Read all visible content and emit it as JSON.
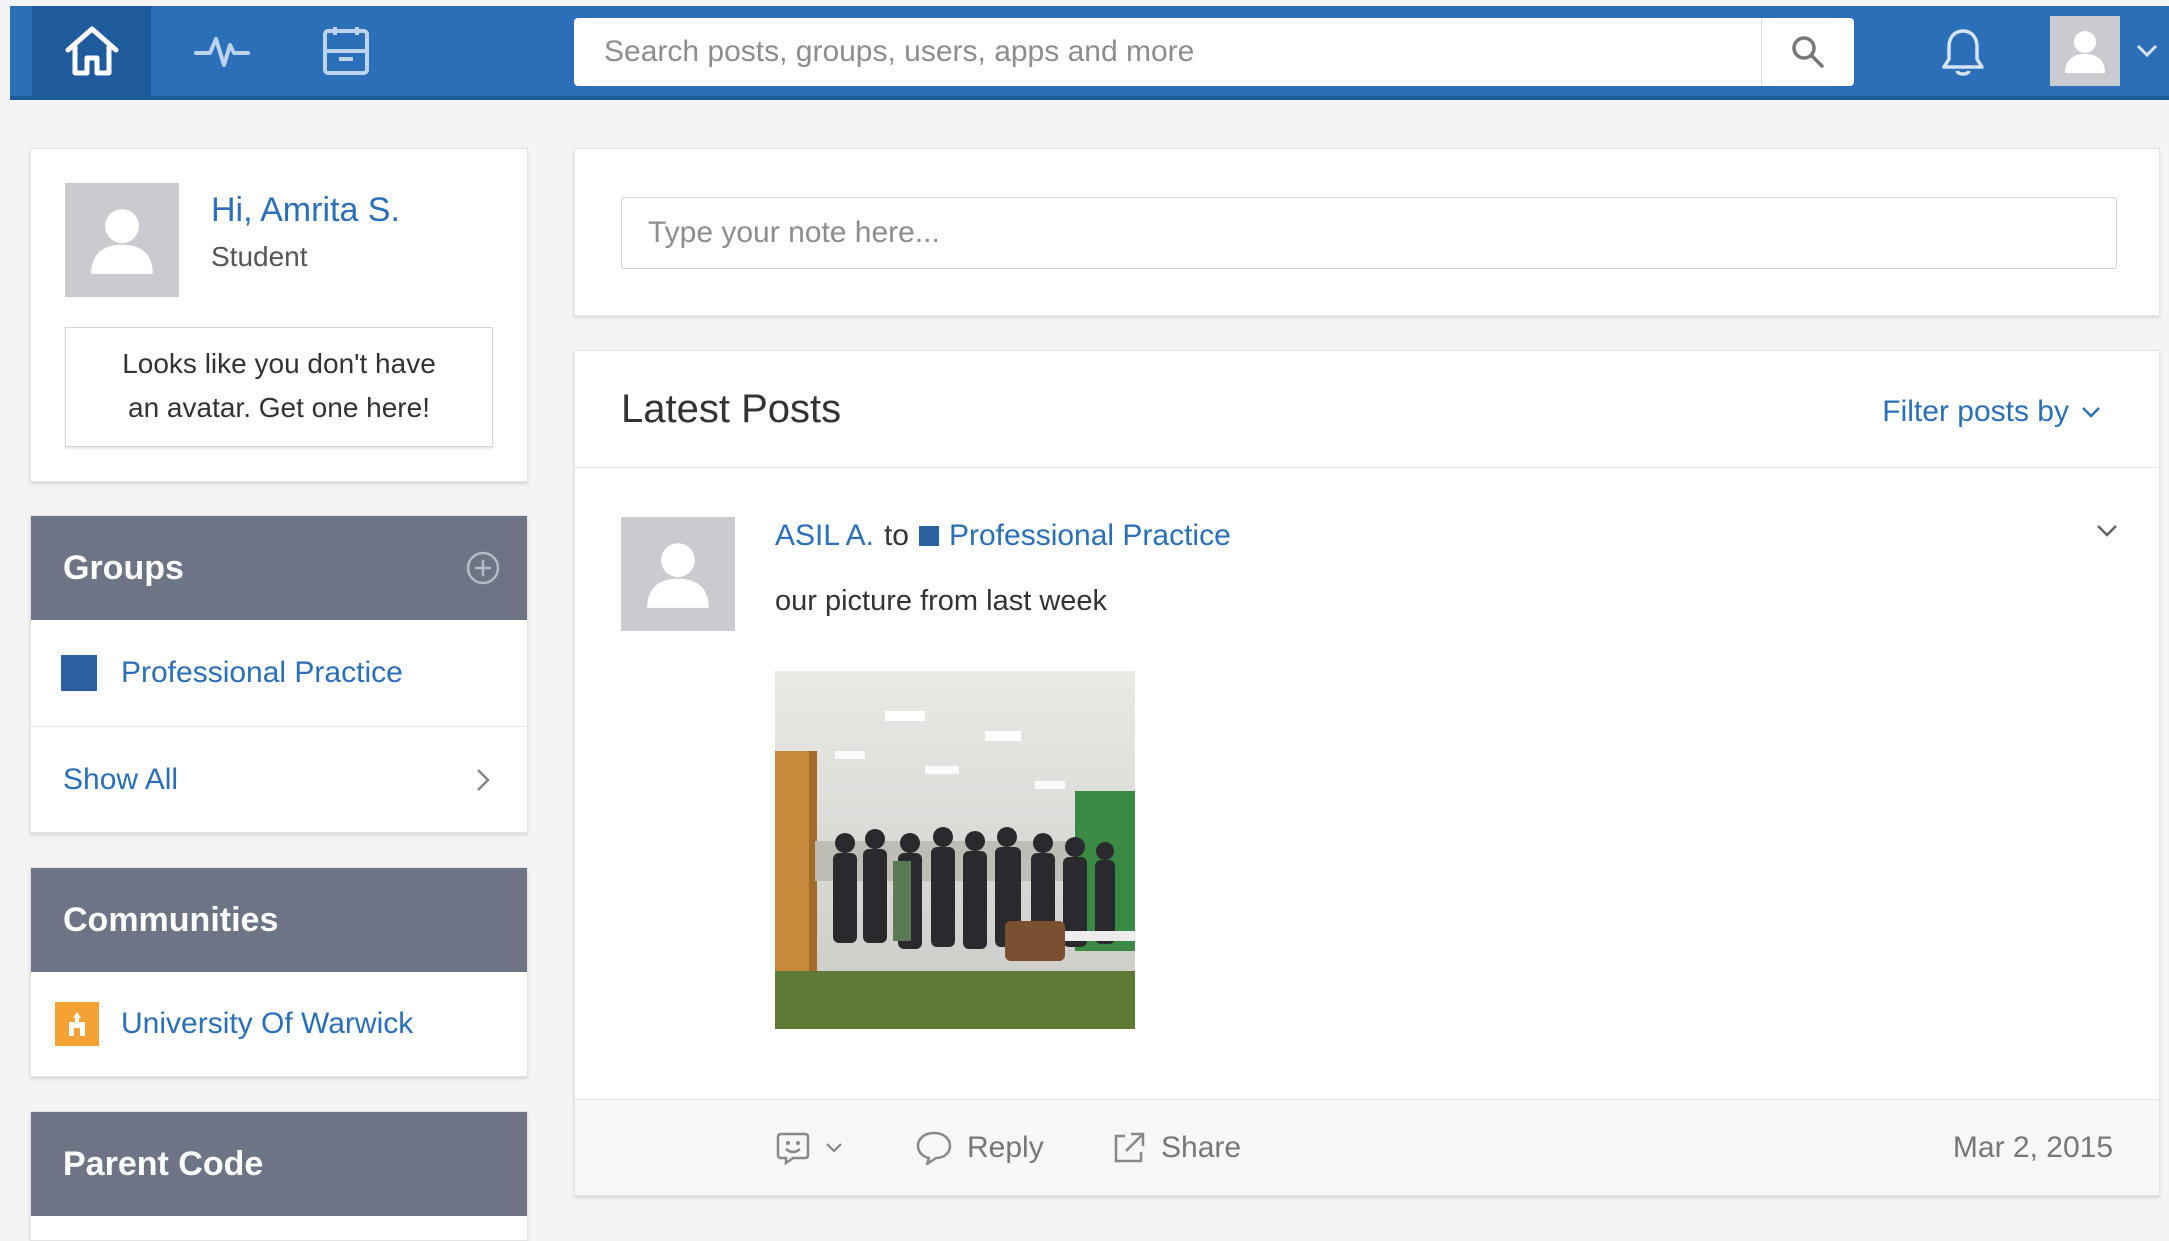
{
  "topbar": {
    "search": {
      "placeholder": "Search posts, groups, users, apps and more"
    }
  },
  "profile": {
    "greeting": "Hi, Amrita S.",
    "role": "Student",
    "avatar_cta_line1": "Looks like you don't have",
    "avatar_cta_line2": "an avatar. Get one here!"
  },
  "groups": {
    "title": "Groups",
    "items": [
      {
        "label": "Professional Practice",
        "color": "#2a5fa0"
      }
    ],
    "show_all": "Show All"
  },
  "communities": {
    "title": "Communities",
    "items": [
      {
        "label": "University Of Warwick",
        "color": "#f4a233"
      }
    ]
  },
  "parent_code": {
    "title": "Parent Code"
  },
  "composer": {
    "placeholder": "Type your note here..."
  },
  "posts": {
    "title": "Latest Posts",
    "filter_label": "Filter posts by",
    "items": [
      {
        "author": "ASIL A.",
        "to_word": "to",
        "group": "Professional Practice",
        "body": "our picture from last week",
        "reply_label": "Reply",
        "share_label": "Share",
        "date": "Mar 2, 2015"
      }
    ]
  },
  "colors": {
    "brand": "#2a6fb8",
    "panel_header": "#6d7485",
    "group_square": "#2a5fa0",
    "community_square": "#f4a233"
  }
}
